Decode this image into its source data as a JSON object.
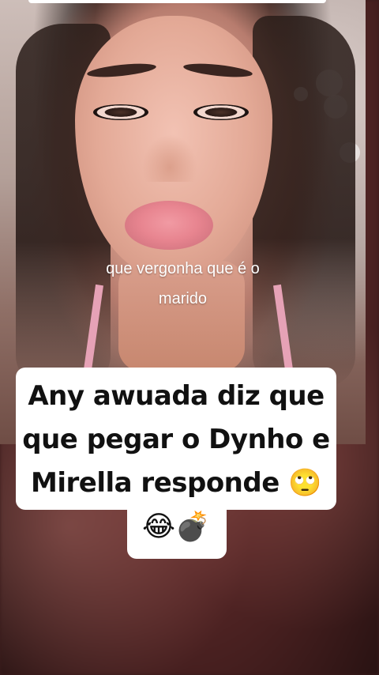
{
  "video": {
    "caption_line1": "que vergonha que é o",
    "caption_line2": "marido"
  },
  "headline": {
    "line1": "Any awuada diz que",
    "line2": "que pegar o Dynho e",
    "line3": "Mirella responde 🙄",
    "line4": "😂💣"
  }
}
